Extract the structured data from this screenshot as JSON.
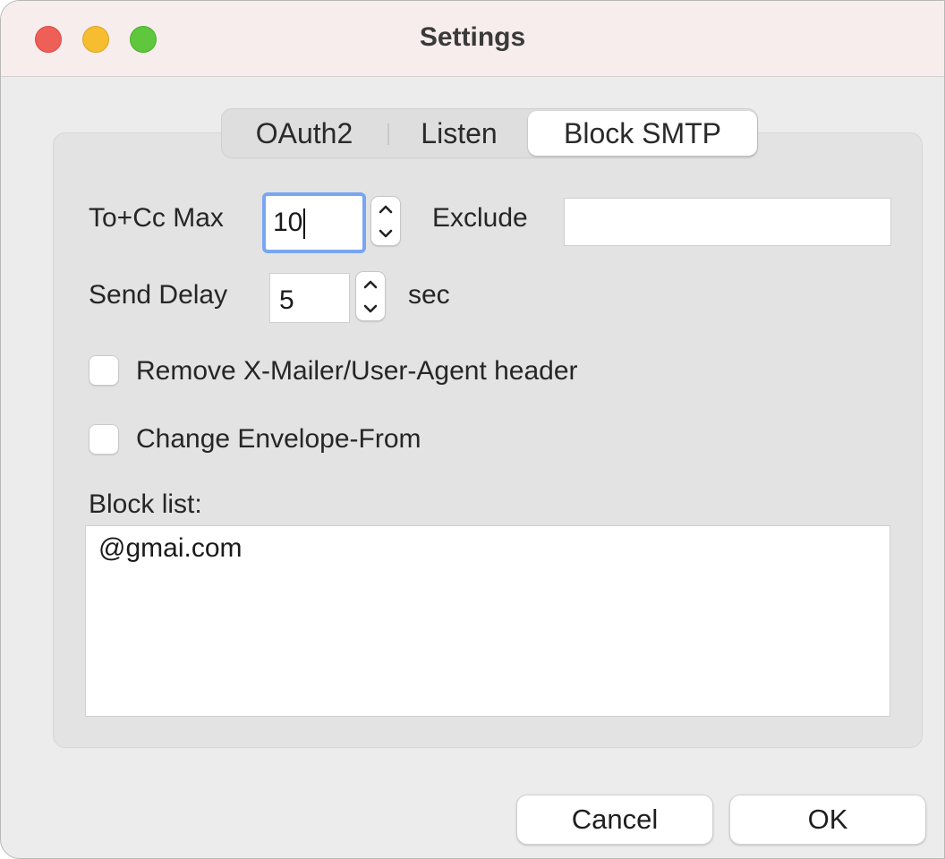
{
  "window": {
    "title": "Settings"
  },
  "tabs": [
    {
      "label": "OAuth2",
      "selected": false
    },
    {
      "label": "Listen",
      "selected": false
    },
    {
      "label": "Block SMTP",
      "selected": true
    }
  ],
  "form": {
    "to_cc_max": {
      "label": "To+Cc Max",
      "value": "10"
    },
    "exclude": {
      "label": "Exclude",
      "value": ""
    },
    "send_delay": {
      "label": "Send Delay",
      "value": "5",
      "unit": "sec"
    },
    "remove_xmailer": {
      "label": "Remove X-Mailer/User-Agent header",
      "checked": false
    },
    "change_envelope_from": {
      "label": "Change Envelope-From",
      "checked": false
    },
    "block_list": {
      "label": "Block list:",
      "value": "@gmai.com"
    }
  },
  "buttons": {
    "cancel": "Cancel",
    "ok": "OK"
  },
  "colors": {
    "close": "#ed5f57",
    "minimize": "#f5bd2f",
    "zoom": "#5fc73d",
    "focus_ring": "#79a6f3"
  }
}
